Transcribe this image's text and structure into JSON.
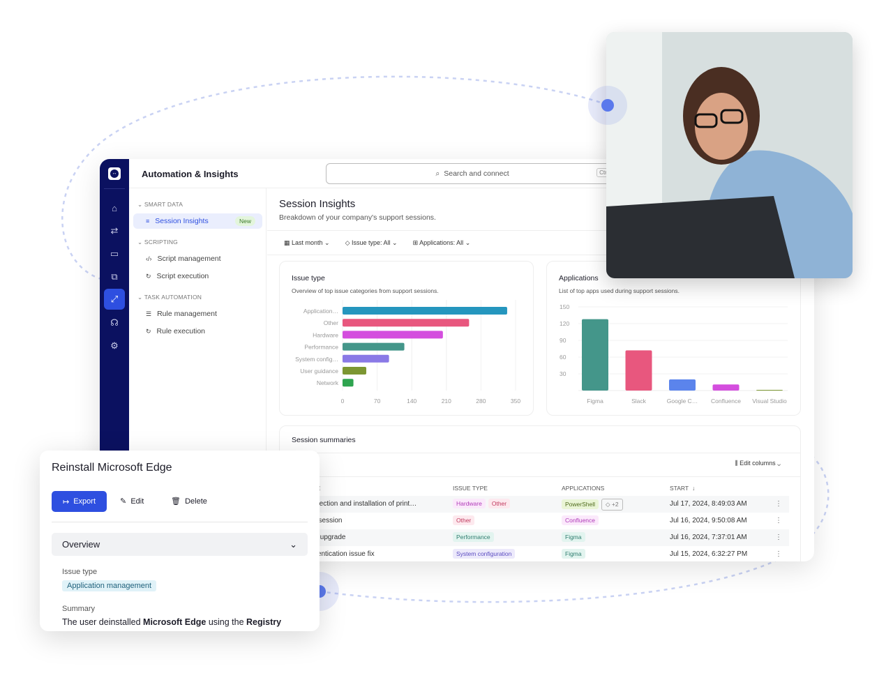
{
  "app": {
    "title": "Automation & Insights",
    "search_placeholder": "Search and connect",
    "search_shortcut": "Ctrl + K"
  },
  "rail": [
    {
      "icon": "home-icon"
    },
    {
      "icon": "transfer-icon"
    },
    {
      "icon": "remote-device-icon"
    },
    {
      "icon": "sessions-icon"
    },
    {
      "icon": "automation-icon",
      "active": true
    },
    {
      "icon": "support-icon"
    },
    {
      "icon": "settings-icon"
    }
  ],
  "nav": {
    "sections": [
      {
        "label": "SMART DATA",
        "items": [
          {
            "label": "Session Insights",
            "badge": "New",
            "selected": true
          }
        ]
      },
      {
        "label": "SCRIPTING",
        "items": [
          {
            "label": "Script management"
          },
          {
            "label": "Script execution"
          }
        ]
      },
      {
        "label": "TASK AUTOMATION",
        "items": [
          {
            "label": "Rule management"
          },
          {
            "label": "Rule execution"
          }
        ]
      }
    ]
  },
  "page": {
    "title": "Session Insights",
    "subtitle": "Breakdown of your company's support sessions.",
    "filters": [
      "Last month",
      "Issue type: All",
      "Applications: All"
    ]
  },
  "chart_data": [
    {
      "type": "bar",
      "orientation": "horizontal",
      "title": "Issue type",
      "subtitle": "Overview of top issue categories from support sessions.",
      "categories": [
        "Application…",
        "Other",
        "Hardware",
        "Performance",
        "System config…",
        "User guidance",
        "Network"
      ],
      "values": [
        333,
        256,
        203,
        125,
        94,
        48,
        22
      ],
      "colors": [
        "#2596be",
        "#e8577e",
        "#d44ede",
        "#44968a",
        "#8a79e6",
        "#7c9632",
        "#2ea44f"
      ],
      "xlim": [
        0,
        350
      ],
      "xticks": [
        0,
        70,
        140,
        210,
        280,
        350
      ],
      "grid": true
    },
    {
      "type": "bar",
      "title": "Applications",
      "subtitle": "List of top apps used during support sessions.",
      "categories": [
        "Figma",
        "Slack",
        "Google C…",
        "Confluence",
        "Visual Studio"
      ],
      "values": [
        128,
        72,
        20,
        11,
        1
      ],
      "colors": [
        "#44968a",
        "#e8577e",
        "#5b84ec",
        "#d44ede",
        "#7c9632"
      ],
      "ylim": [
        0,
        150
      ],
      "yticks": [
        30,
        60,
        90,
        120,
        150
      ],
      "grid": true
    }
  ],
  "summaries": {
    "title": "Session summaries",
    "edit_columns": "Edit columns",
    "columns": [
      "AME",
      "ISSUE TYPE",
      "APPLICATIONS",
      "START"
    ],
    "rows": [
      {
        "name": "onnection and installation of print…",
        "issues": [
          "Hardware",
          "Other"
        ],
        "apps": [
          "PowerShell"
        ],
        "more": "+2",
        "start": "Jul 17, 2024, 8:49:03 AM"
      },
      {
        "name": "ew session",
        "issues": [
          "Other"
        ],
        "apps": [
          "Confluence"
        ],
        "start": "Jul 16, 2024, 9:50:08 AM"
      },
      {
        "name": "AM upgrade",
        "issues": [
          "Performance"
        ],
        "apps": [
          "Figma"
        ],
        "start": "Jul 16, 2024, 7:37:01 AM"
      },
      {
        "name": "uthentication issue fix",
        "issues": [
          "System configuration"
        ],
        "apps": [
          "Figma"
        ],
        "start": "Jul 15, 2024, 6:32:27 PM"
      }
    ]
  },
  "tag_colors": {
    "Hardware": [
      "#fbe9fb",
      "#b03bb8"
    ],
    "Other": [
      "#fde9ee",
      "#c0395e"
    ],
    "Performance": [
      "#e2f4ef",
      "#2f7d6f"
    ],
    "System configuration": [
      "#ece9fb",
      "#5a4bc0"
    ],
    "PowerShell": [
      "#eaf5d6",
      "#4f6b1c"
    ],
    "Confluence": [
      "#fbe9fb",
      "#b03bb8"
    ],
    "Figma": [
      "#e2f4ef",
      "#2f7d6f"
    ]
  },
  "detail": {
    "title": "Reinstall Microsoft Edge",
    "export": "Export",
    "edit": "Edit",
    "delete": "Delete",
    "overview": "Overview",
    "issue_label": "Issue type",
    "issue_value": "Application management",
    "summary_label": "Summary",
    "summary_pre": "The user deinstalled ",
    "summary_b1": "Microsoft Edge",
    "summary_mid": " using the ",
    "summary_b2": "Registry"
  },
  "accent": "#2e4fe0"
}
